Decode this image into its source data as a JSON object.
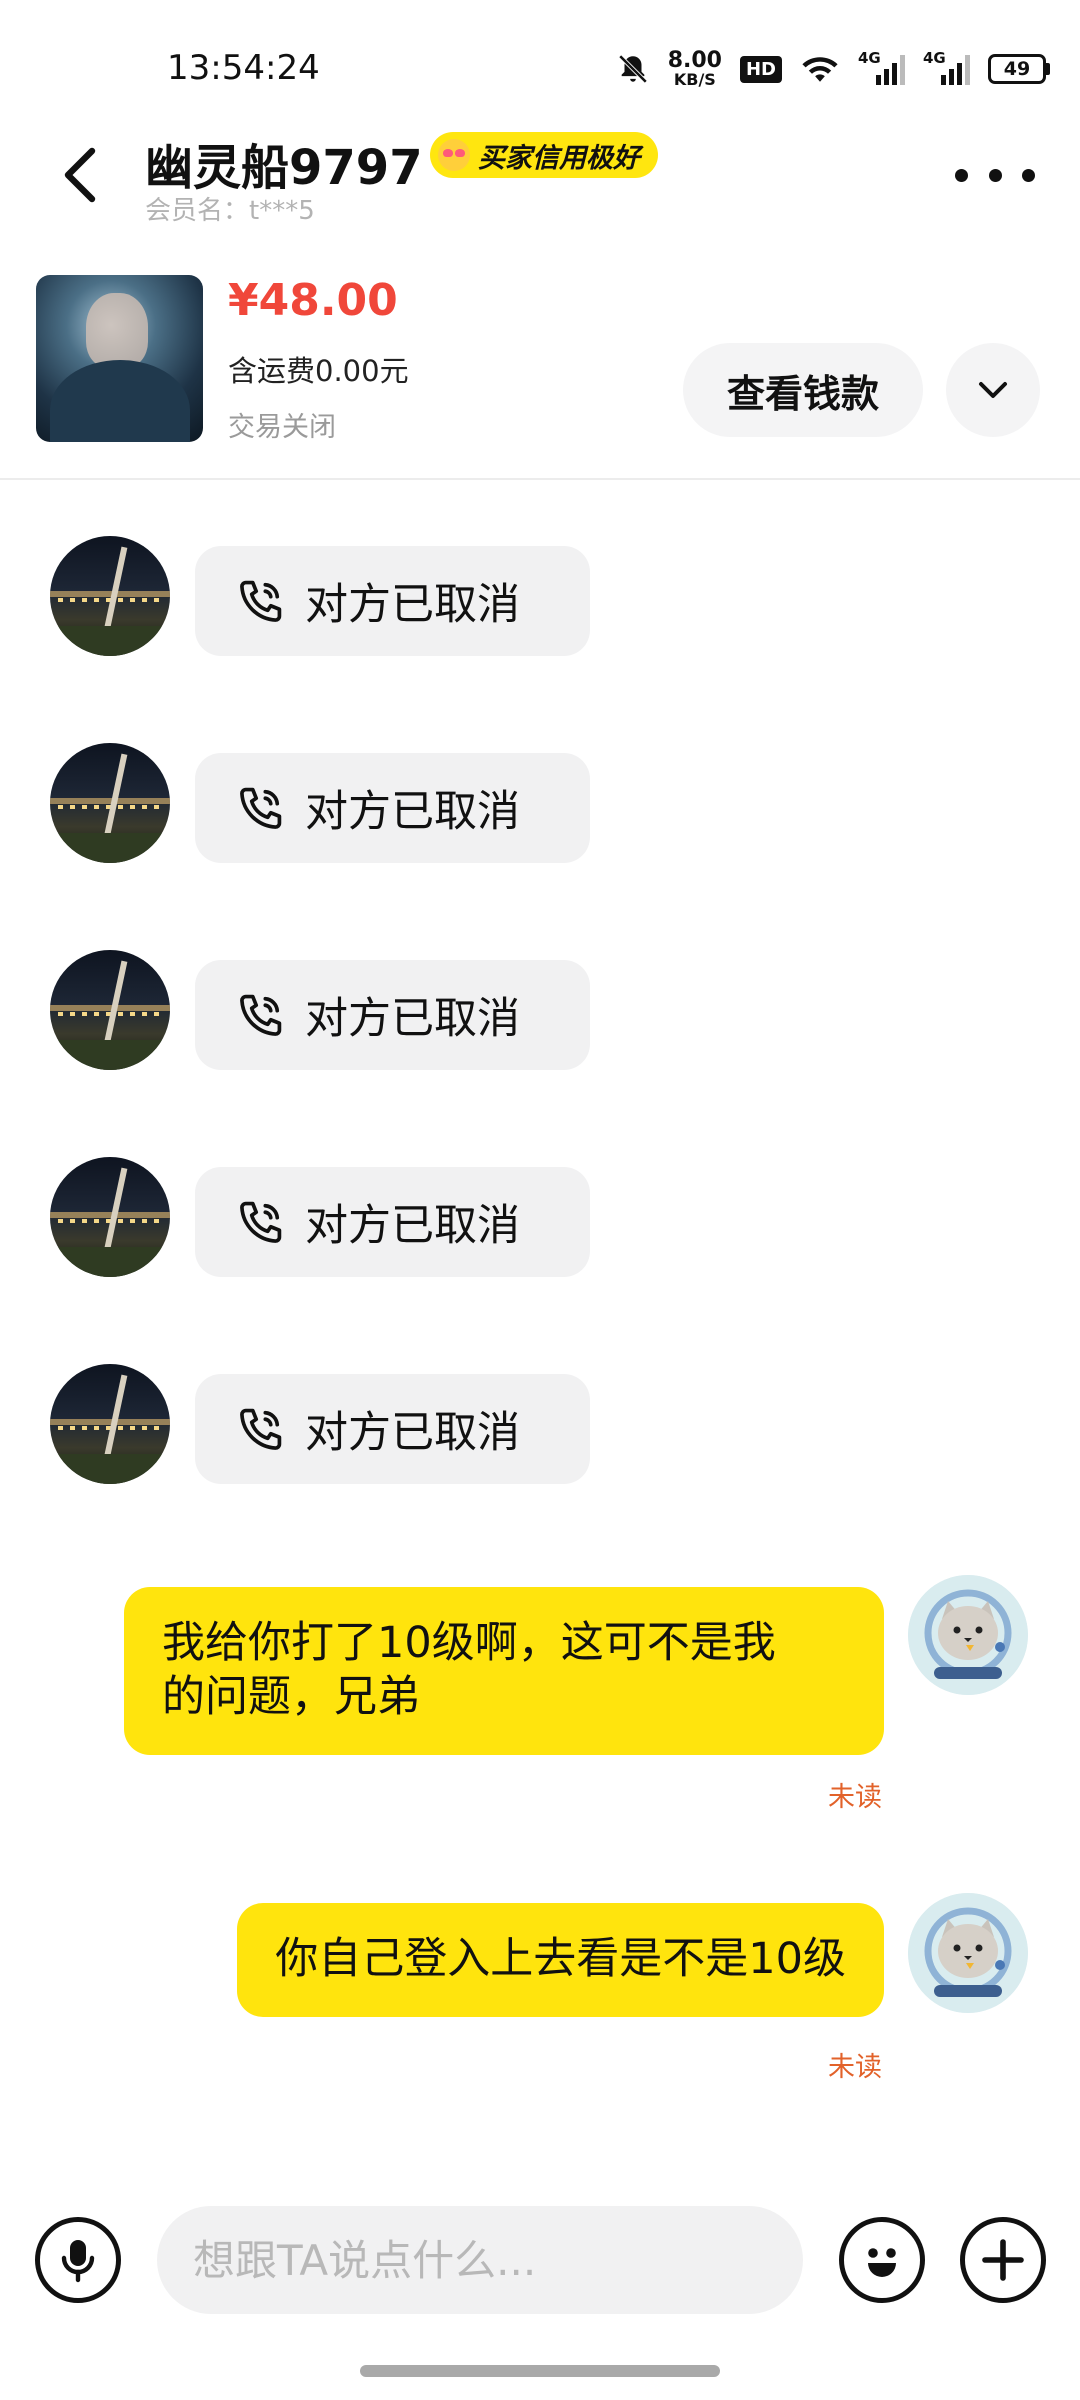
{
  "status_bar": {
    "time": "13:54:24",
    "net_speed_value": "8.00",
    "net_speed_unit": "KB/S",
    "hd_label": "HD",
    "signal_1_label": "4G",
    "signal_2_label": "4G",
    "battery": "49",
    "icons": [
      "bell-off-icon",
      "wifi-icon",
      "signal-icon",
      "battery-icon"
    ]
  },
  "header": {
    "contact_name": "幽灵船9797",
    "credit_badge": "买家信用极好",
    "member_label": "会员名：t***5"
  },
  "product": {
    "price": "¥48.00",
    "shipping": "含运费0.00元",
    "status": "交易关闭",
    "view_payment_label": "查看钱款"
  },
  "messages": {
    "call_cancelled": [
      {
        "text": "对方已取消"
      },
      {
        "text": "对方已取消"
      },
      {
        "text": "对方已取消"
      },
      {
        "text": "对方已取消"
      },
      {
        "text": "对方已取消"
      }
    ],
    "sent": [
      {
        "text_line1": "我给你打了10级啊，这可不是我",
        "text_line2": "的问题，兄弟",
        "status": "未读"
      },
      {
        "text_line1": "你自己登入上去看是不是10级",
        "status": "未读"
      }
    ]
  },
  "input_bar": {
    "placeholder": "想跟TA说点什么..."
  },
  "colors": {
    "accent_yellow": "#ffe40d",
    "price_red": "#f0473a",
    "unread_orange": "#e2622a"
  }
}
